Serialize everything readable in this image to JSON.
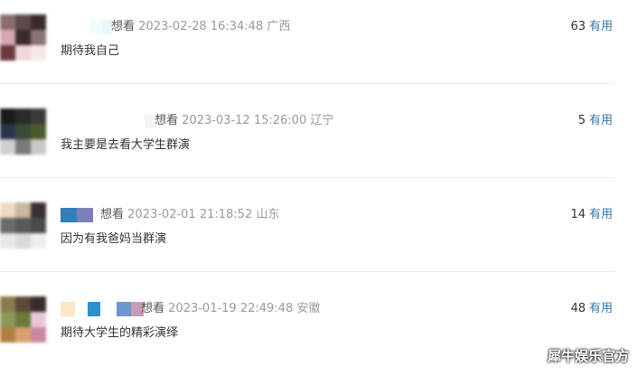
{
  "comments": [
    {
      "want_label": "想看",
      "time": "2023-02-28 16:34:48",
      "region": "广西",
      "content": "期待我自己",
      "useful_count": "63",
      "useful_label": "有用",
      "avatar_colors": [
        "#8a6e6e",
        "#5b4a4a",
        "#3a2b2b",
        "#d8a6b0",
        "#3b2c2c",
        "#8a7277",
        "#6a3a3f",
        "#f2d7d9",
        "#f7e8e8"
      ],
      "nick_colors": [
        "#f0fbfe",
        "#e6f7fb"
      ]
    },
    {
      "want_label": "想看",
      "time": "2023-03-12 15:26:00",
      "region": "辽宁",
      "content": "我主要是去看大学生群演",
      "useful_count": "5",
      "useful_label": "有用",
      "avatar_colors": [
        "#1a1a1a",
        "#2a2a2a",
        "#3a3a3a",
        "#273449",
        "#3b4a3a",
        "#4a5a2a",
        "#d0d0d0",
        "#7a7a7a",
        "#c8c8c8"
      ],
      "nick_colors": [
        "#f5f5f5"
      ]
    },
    {
      "want_label": "想看",
      "time": "2023-02-01 21:18:52",
      "region": "山东",
      "content": "因为有我爸妈当群演",
      "useful_count": "14",
      "useful_label": "有用",
      "avatar_colors": [
        "#ecd9c4",
        "#c9b7a3",
        "#3a3030",
        "#6a6a6a",
        "#5a5a5a",
        "#4a4a4a",
        "#e8e8e8",
        "#d9d9d9",
        "#eeeeee"
      ],
      "nick_colors": [
        "#2f7fb8",
        "#7d7fbd"
      ]
    },
    {
      "want_label": "想看",
      "time": "2023-01-19 22:49:48",
      "region": "安徽",
      "content": "期待大学生的精彩演绎",
      "useful_count": "48",
      "useful_label": "有用",
      "avatar_colors": [
        "#8b7a4a",
        "#5a4a3a",
        "#3a2a2a",
        "#8a9a5a",
        "#6a7a3a",
        "#e8c8d8",
        "#b08040",
        "#d8a070",
        "#c88aa0"
      ],
      "nick_colors": [
        "#fbe8c4",
        "#2e8fd0",
        "#6d95d0",
        "#c99bb5"
      ]
    }
  ],
  "watermark": "犀牛娱乐官方"
}
